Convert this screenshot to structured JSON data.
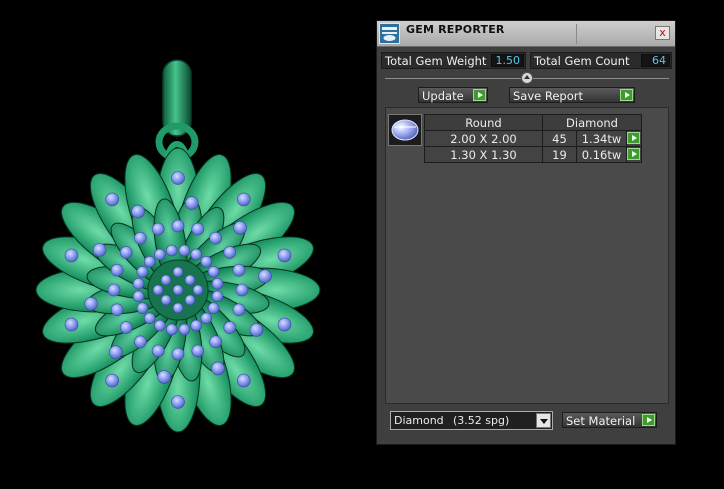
{
  "panel": {
    "title": "GEM REPORTER",
    "close_label": "x",
    "total_weight": {
      "label": "Total Gem Weight",
      "value": "1.50"
    },
    "total_count": {
      "label": "Total Gem Count",
      "value": "64"
    },
    "update_button": "Update",
    "save_report_button": "Save Report",
    "table": {
      "headers": [
        "Round",
        "Diamond"
      ],
      "rows": [
        {
          "size": "2.00 X 2.00",
          "count": "45",
          "weight": "1.34tw"
        },
        {
          "size": "1.30 X 1.30",
          "count": "19",
          "weight": "0.16tw"
        }
      ]
    },
    "material": {
      "name": "Diamond",
      "spg": "(3.52 spg)"
    },
    "set_material_button": "Set Material"
  },
  "colors": {
    "metal": "#2a9e72",
    "gem": "#8a9cf2",
    "value_text": "#59c6e9",
    "go_green": "#3c9c2c"
  }
}
